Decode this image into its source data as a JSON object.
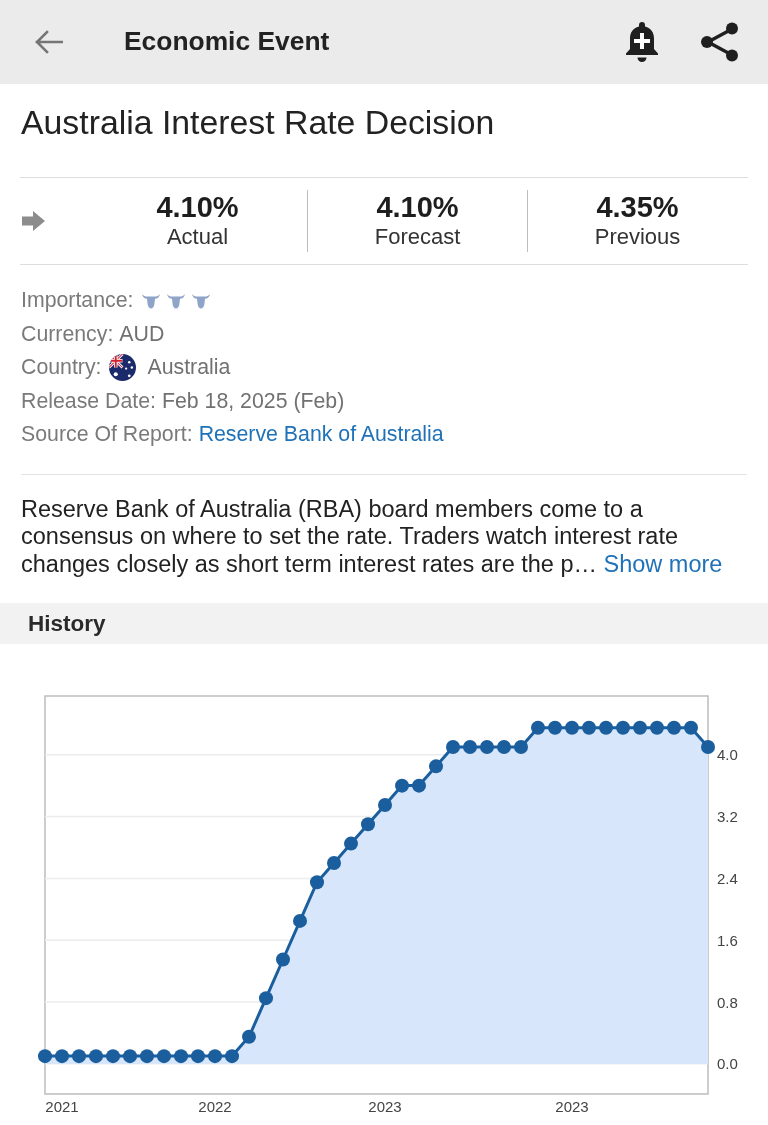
{
  "header": {
    "title": "Economic Event"
  },
  "event": {
    "title": "Australia Interest Rate Decision"
  },
  "stats": [
    {
      "value": "4.10%",
      "label": "Actual"
    },
    {
      "value": "4.10%",
      "label": "Forecast"
    },
    {
      "value": "4.35%",
      "label": "Previous"
    }
  ],
  "details": [
    {
      "kind": "rating",
      "label": "Importance:",
      "stars": 3
    },
    {
      "kind": "text",
      "label": "Currency:",
      "value": "AUD"
    },
    {
      "kind": "flag",
      "label": "Country:",
      "value": "Australia"
    },
    {
      "kind": "text",
      "label": "Release Date:",
      "value": "Feb 18, 2025 (Feb)"
    },
    {
      "kind": "link",
      "label": "Source Of Report:",
      "value": "Reserve Bank of Australia"
    }
  ],
  "description": {
    "text": "Reserve Bank of Australia (RBA) board members come to a consensus on where to set the rate. Traders watch interest rate changes closely as short term interest rates are the p…",
    "link": "Show more"
  },
  "history": {
    "title": "History",
    "chart_data": {
      "type": "area",
      "grid": true,
      "categories": [
        null,
        "2021",
        null,
        null,
        null,
        null,
        null,
        null,
        null,
        null,
        "2022",
        null,
        null,
        null,
        null,
        null,
        null,
        null,
        null,
        null,
        "2023",
        null,
        null,
        null,
        null,
        null,
        null,
        null,
        null,
        null,
        null,
        "2023",
        null,
        null,
        null,
        null,
        null,
        null,
        null,
        null
      ],
      "values": [
        0.1,
        0.1,
        0.1,
        0.1,
        0.1,
        0.1,
        0.1,
        0.1,
        0.1,
        0.1,
        0.1,
        0.1,
        0.35,
        0.85,
        1.35,
        1.85,
        2.35,
        2.6,
        2.85,
        3.1,
        3.35,
        3.6,
        3.6,
        3.85,
        4.1,
        4.1,
        4.1,
        4.1,
        4.1,
        4.35,
        4.35,
        4.35,
        4.35,
        4.35,
        4.35,
        4.35,
        4.35,
        4.35,
        4.35,
        4.1
      ],
      "ylim": [
        -0.39,
        4.76
      ],
      "yticks": [
        {
          "value": 0,
          "label": "0.0"
        },
        {
          "value": 0.8,
          "label": "0.8"
        },
        {
          "value": 1.6,
          "label": "1.6"
        },
        {
          "value": 2.4,
          "label": "2.4"
        },
        {
          "value": 3.2,
          "label": "3.2"
        },
        {
          "value": 4,
          "label": "4.0"
        }
      ]
    }
  }
}
